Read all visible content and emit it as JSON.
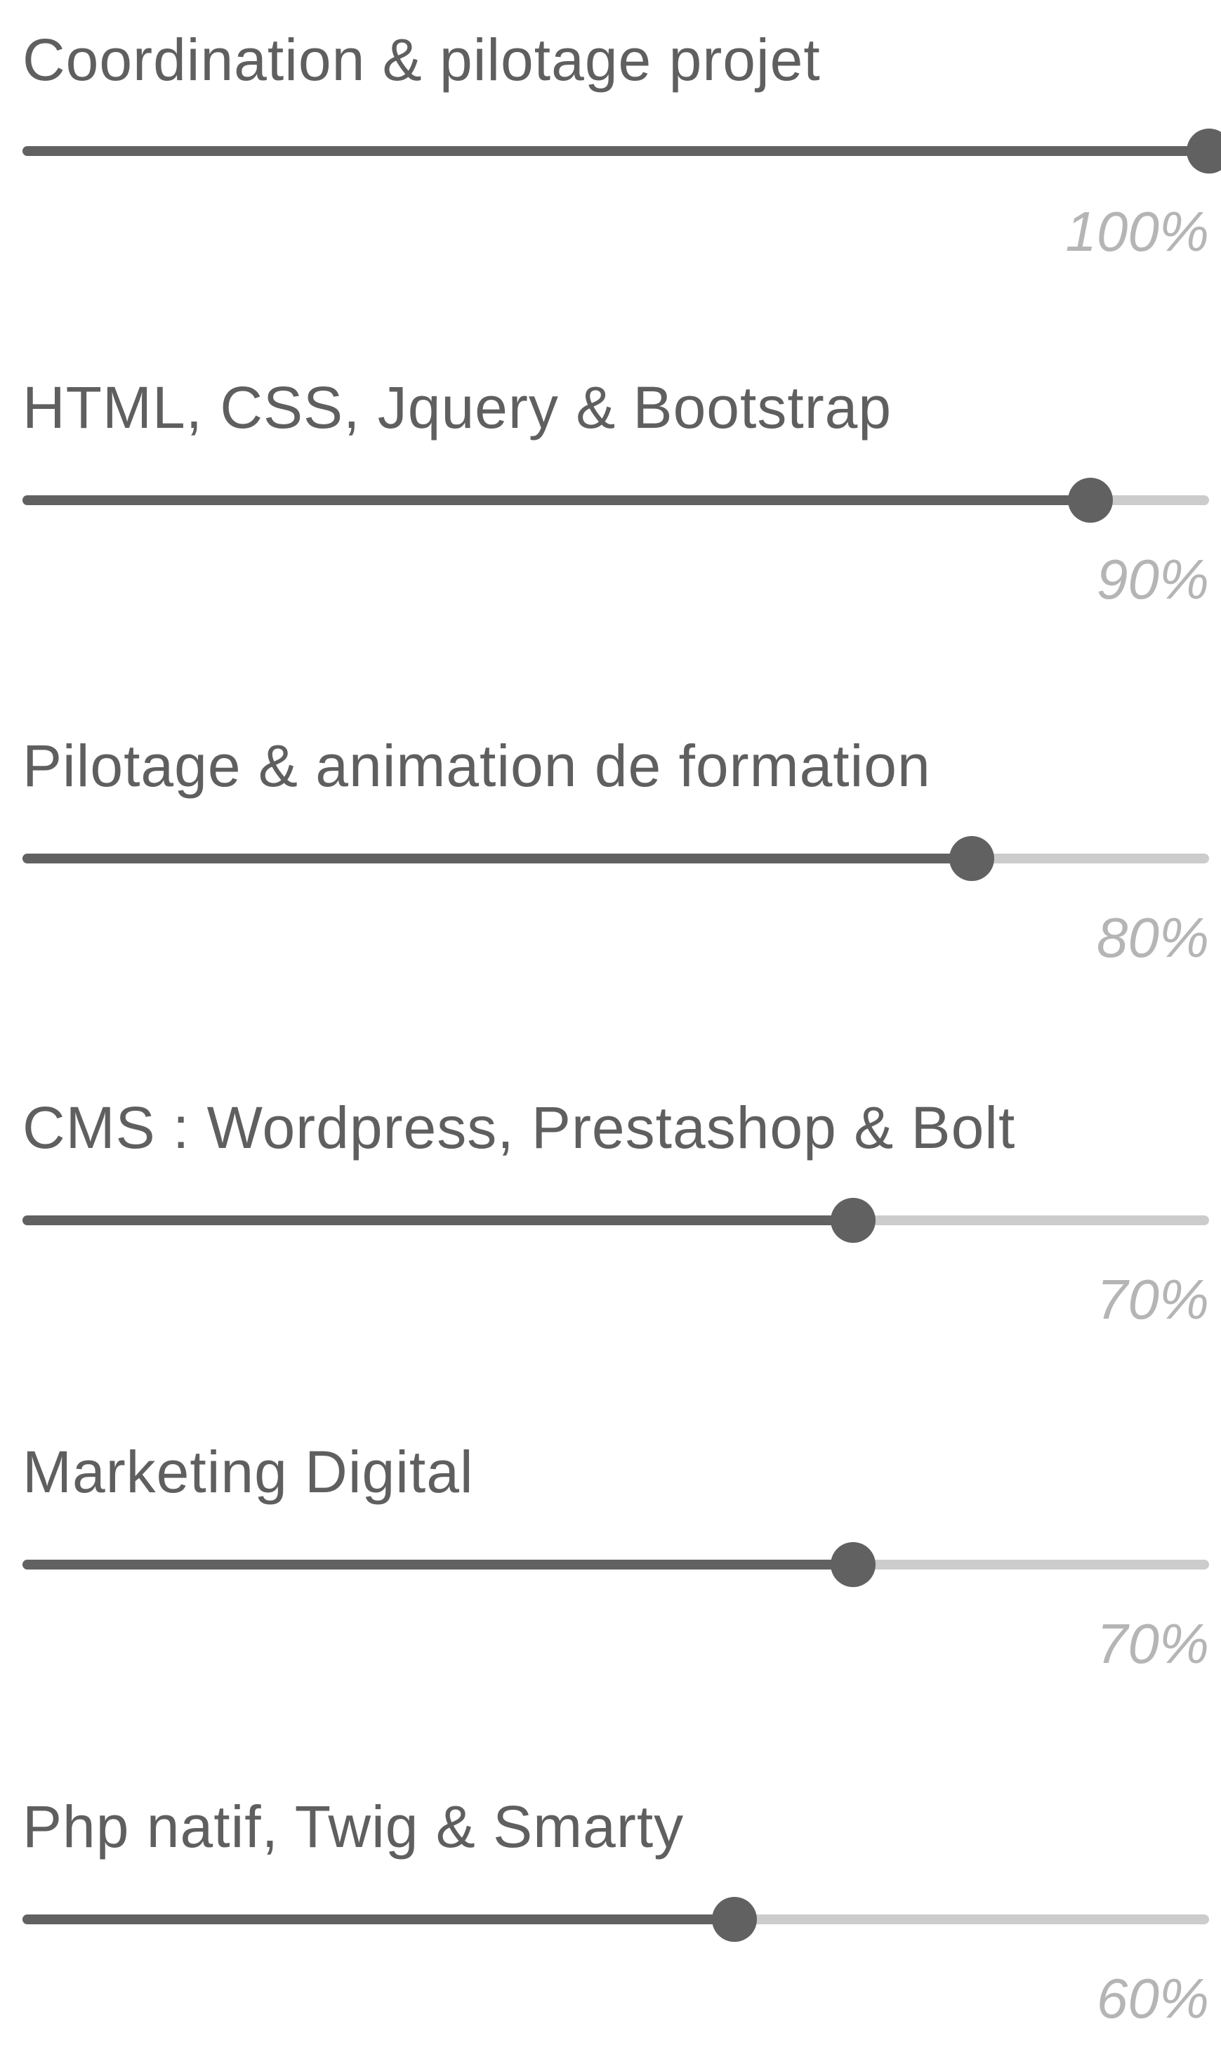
{
  "skills": [
    {
      "label": "Coordination & pilotage projet",
      "value": 1.0,
      "percent_label": "100%"
    },
    {
      "label": "HTML, CSS, Jquery & Bootstrap",
      "value": 0.9,
      "percent_label": "90%"
    },
    {
      "label": "Pilotage & animation de formation",
      "value": 0.8,
      "percent_label": "80%"
    },
    {
      "label": "CMS : Wordpress, Prestashop & Bolt",
      "value": 0.7,
      "percent_label": "70%"
    },
    {
      "label": "Marketing Digital",
      "value": 0.7,
      "percent_label": "70%"
    },
    {
      "label": "Php natif, Twig & Smarty",
      "value": 0.6,
      "percent_label": "60%"
    }
  ],
  "colors": {
    "fill": "#616161",
    "track": "#cccccc",
    "label": "#5f5f5f",
    "percent": "#b5b5b5"
  }
}
